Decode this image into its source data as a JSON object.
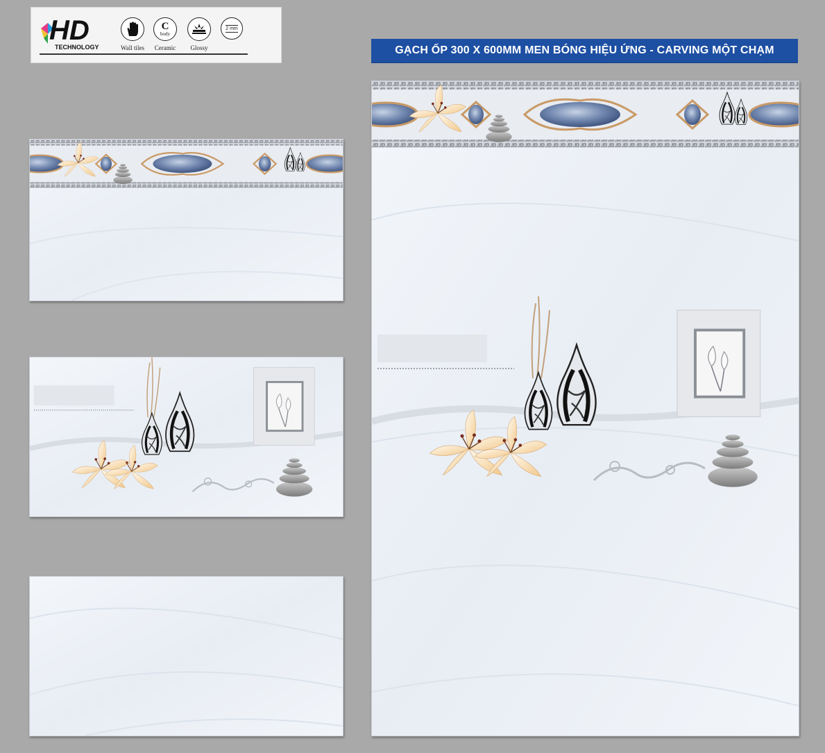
{
  "logo": {
    "brand": "HD",
    "subtitle": "TECHNOLOGY"
  },
  "features": [
    {
      "icon": "hand-icon",
      "label": "Wall tiles"
    },
    {
      "icon": "ceramic-body-icon",
      "glyph": "C",
      "glyph_sub": "body",
      "label": "Ceramic"
    },
    {
      "icon": "glossy-icon",
      "label": "Glossy"
    },
    {
      "icon": "thickness-icon",
      "glyph": "2 mm",
      "label": ""
    }
  ],
  "title": "GẠCH ỐP 300 X 600MM MEN BÓNG HIỆU ỨNG - CARVING MỘT CHẠM",
  "tiles": [
    {
      "id": "border-tile",
      "kind": "border-decor"
    },
    {
      "id": "decor-tile",
      "kind": "vase-decor"
    },
    {
      "id": "plain-tile",
      "kind": "plain-marble"
    },
    {
      "id": "wall-preview",
      "kind": "combined-preview"
    }
  ],
  "colors": {
    "title_bar": "#1d4fa3",
    "marble": "#eef2f7",
    "gem": "#6f86ad",
    "gold": "#c99a66",
    "background": "#a9a9a9"
  }
}
